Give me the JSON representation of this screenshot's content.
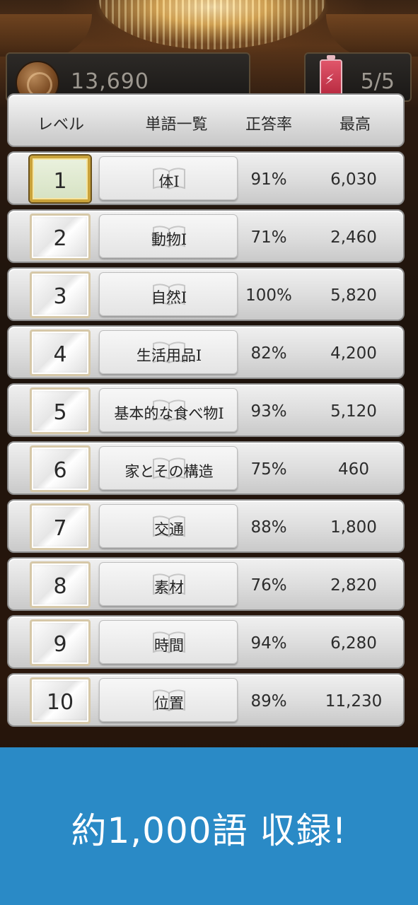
{
  "status": {
    "coins": "13,690",
    "energy": "5/5",
    "coin_icon": "coin-stack-icon",
    "energy_icon": "battery-bolt-icon"
  },
  "table": {
    "headers": {
      "level": "レベル",
      "words": "単語一覧",
      "rate": "正答率",
      "best": "最高"
    },
    "rows": [
      {
        "level": "1",
        "word": "体Ⅰ",
        "rate": "91%",
        "best": "6,030",
        "selected": true
      },
      {
        "level": "2",
        "word": "動物Ⅰ",
        "rate": "71%",
        "best": "2,460",
        "selected": false
      },
      {
        "level": "3",
        "word": "自然Ⅰ",
        "rate": "100%",
        "best": "5,820",
        "selected": false
      },
      {
        "level": "4",
        "word": "生活用品Ⅰ",
        "rate": "82%",
        "best": "4,200",
        "selected": false
      },
      {
        "level": "5",
        "word": "基本的な食べ物Ⅰ",
        "rate": "93%",
        "best": "5,120",
        "selected": false
      },
      {
        "level": "6",
        "word": "家とその構造",
        "rate": "75%",
        "best": "460",
        "selected": false
      },
      {
        "level": "7",
        "word": "交通",
        "rate": "88%",
        "best": "1,800",
        "selected": false
      },
      {
        "level": "8",
        "word": "素材",
        "rate": "76%",
        "best": "2,820",
        "selected": false
      },
      {
        "level": "9",
        "word": "時間",
        "rate": "94%",
        "best": "6,280",
        "selected": false
      },
      {
        "level": "10",
        "word": "位置",
        "rate": "89%",
        "best": "11,230",
        "selected": false
      }
    ]
  },
  "banner": {
    "text": "約1,000語 収録!",
    "color": "#2a8ac6"
  }
}
